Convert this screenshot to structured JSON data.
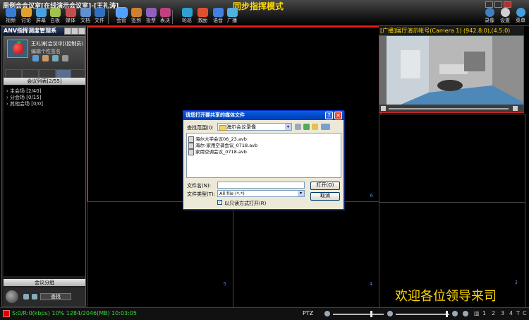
{
  "window": {
    "title": "周例会会议室[在线演示会议室]-[王礼涛]",
    "mode_title": "同步指挥模式"
  },
  "toolbar": {
    "items": [
      {
        "label": "视频",
        "color": "#3a7bd5"
      },
      {
        "label": "讨论",
        "color": "#e0a030"
      },
      {
        "label": "屏幕",
        "color": "#4aa0e0"
      },
      {
        "label": "白板",
        "color": "#a0c050"
      },
      {
        "label": "媒体",
        "color": "#c05050"
      },
      {
        "label": "文档",
        "color": "#6090d0"
      },
      {
        "label": "文件",
        "color": "#3070c0"
      },
      {
        "label": "会管",
        "color": "#4fa3ff"
      },
      {
        "label": "签到",
        "color": "#d08030"
      },
      {
        "label": "投票",
        "color": "#9060c0"
      },
      {
        "label": "表决",
        "color": "#c04080"
      },
      {
        "label": "轮巡",
        "color": "#30a0d0"
      },
      {
        "label": "激励",
        "color": "#e05030"
      },
      {
        "label": "语音",
        "color": "#4080e0"
      },
      {
        "label": "广播",
        "color": "#50b0e0"
      }
    ],
    "right_items": [
      {
        "label": "录像",
        "color": "#4080c0"
      },
      {
        "label": "设置",
        "color": "#d0d0d0"
      },
      {
        "label": "菜单",
        "color": "#40a0e0"
      }
    ]
  },
  "left_panel": {
    "title": "ANV指挥调度管理系",
    "user": {
      "name": "王礼涛[会议中](控制员)",
      "signature": "编辑个性签名"
    },
    "meeting_list_header": "会议列表[2/55]",
    "tree": [
      {
        "label": "主会场 [2/40]"
      },
      {
        "label": "分会场 [0/15]"
      },
      {
        "label": "其他会场 [0/0]"
      }
    ],
    "group_button": "会议分组",
    "find_button": "查找"
  },
  "video_cells": {
    "cell6": "6",
    "cell5": "5",
    "cell4": "4",
    "cell3": "3"
  },
  "camera": {
    "header": "[广播]展厅演示帐号(Camera 1) (942.8:0),(4.5:0)"
  },
  "welcome_text": "欢迎各位领导来司",
  "status_bar": {
    "stats": "S:0/R:0(kbps) 10% 1284/2046(MB)",
    "time": "10:03:05",
    "ptz": "PTZ",
    "nums": [
      "1",
      "2",
      "3",
      "4",
      "T",
      "C"
    ]
  },
  "dialog": {
    "title": "请您打开要共享的媒体文件",
    "look_in_label": "查找范围(I):",
    "look_in_value": "海尔会议录像",
    "files": [
      "海尔大学会议06_23.avb",
      "海尔-家用空调会议_0718.avb",
      "家用空调会议_0718.avb"
    ],
    "file_name_label": "文件名(N):",
    "file_name_value": "",
    "file_type_label": "文件类型(T):",
    "file_type_value": "All file (*.*)",
    "open_button": "打开(O)",
    "cancel_button": "取消",
    "readonly_label": "以只读方式打开(R)",
    "readonly_checked": true,
    "help_glyph": "?",
    "close_glyph": "✕"
  }
}
